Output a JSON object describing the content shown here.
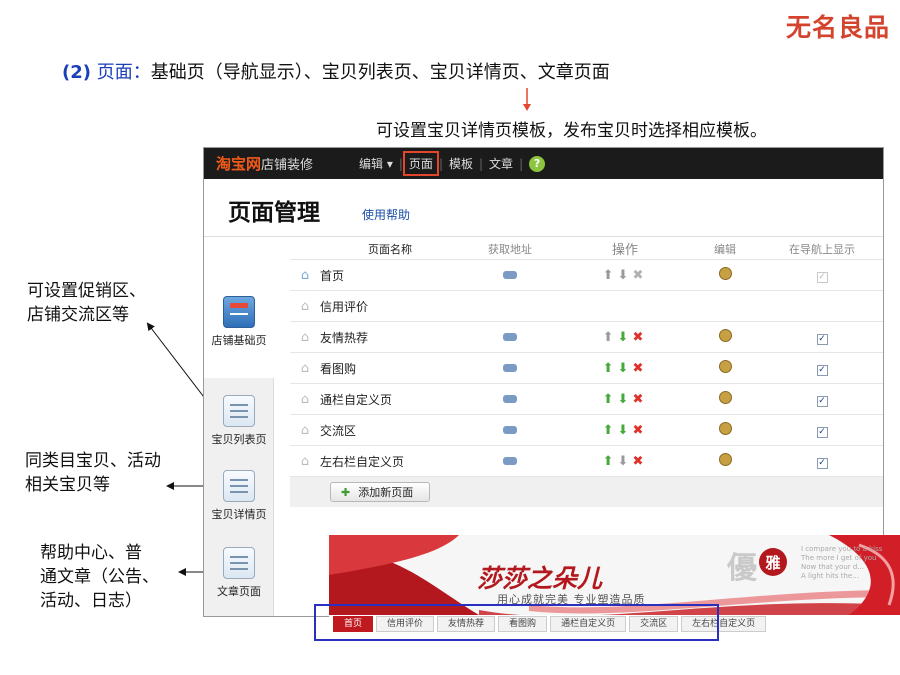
{
  "slide": {
    "logo": "无名良品",
    "heading_num": "(2)",
    "heading_kw": "页面：",
    "heading_rest": "基础页（导航显示）、宝贝列表页、宝贝详情页、文章页面",
    "note_top": "可设置宝贝详情页模板，发布宝贝时选择相应模板。",
    "ann1": [
      "可设置促销区、",
      "店铺交流区等"
    ],
    "ann2": [
      "同类目宝贝、活动",
      "相关宝贝等"
    ],
    "ann3": [
      "帮助中心、普",
      "通文章（公告、",
      "活动、日志）"
    ]
  },
  "app": {
    "topbar": {
      "logo": "淘宝网",
      "subtitle": "店铺装修",
      "menu": [
        {
          "label": "编辑 ▾"
        },
        {
          "label": "页面"
        },
        {
          "label": "模板"
        },
        {
          "label": "文章"
        }
      ],
      "help": "?"
    },
    "title": "页面管理",
    "help_link": "使用帮助",
    "sidebar": [
      {
        "label": "店铺基础页"
      },
      {
        "label": "宝贝列表页"
      },
      {
        "label": "宝贝详情页"
      },
      {
        "label": "文章页面"
      }
    ],
    "table": {
      "headers": {
        "name": "页面名称",
        "url": "获取地址",
        "ops": "操作",
        "edit": "编辑",
        "show": "在导航上显示"
      },
      "rows": [
        {
          "name": "首页"
        },
        {
          "name": "信用评价"
        },
        {
          "name": "友情热荐"
        },
        {
          "name": "看图购"
        },
        {
          "name": "通栏自定义页"
        },
        {
          "name": "交流区"
        },
        {
          "name": "左右栏自定义页"
        }
      ]
    },
    "add_button": "添加新页面"
  },
  "banner": {
    "title": "莎莎之朵儿",
    "slogan": "用心成就完美 专业塑造品质",
    "badge_left": "優",
    "badge_right": "雅",
    "english": [
      "I compare you to a kiss",
      "The more I get of you",
      "Now that your d...",
      "A light hits the..."
    ],
    "nav": [
      {
        "label": "首页"
      },
      {
        "label": "信用评价"
      },
      {
        "label": "友情热荐"
      },
      {
        "label": "看图购"
      },
      {
        "label": "通栏自定义页"
      },
      {
        "label": "交流区"
      },
      {
        "label": "左右栏自定义页"
      }
    ]
  },
  "colors": {
    "accent": "#1a3fb8",
    "taobao_orange": "#f25a18",
    "highlight_red": "#e4462c",
    "nav_blue_box": "#2b2fbf"
  }
}
